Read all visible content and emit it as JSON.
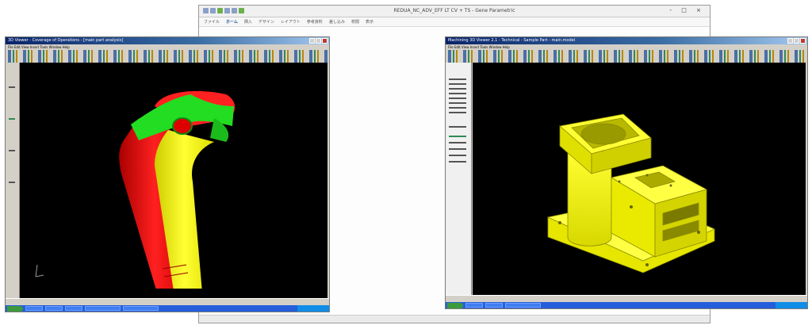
{
  "background_window": {
    "title": "REDUA_NC_ADV_EFF LT CV + TS - Gene Parametric",
    "window_buttons": "- □ ×",
    "ribbon_tabs": [
      "ファイル",
      "ホーム",
      "挿入",
      "デザイン",
      "レイアウト",
      "参考資料",
      "差し込み",
      "校閲",
      "表示"
    ],
    "active_tab_index": 1
  },
  "left_app": {
    "title": "3D Viewer - Coverage of Operations - [main part analysis]",
    "menu": "File  Edit  View  Insert  Tools  Window  Help",
    "model_colors": [
      "#ff1a1a",
      "#ffff1a",
      "#22dd22"
    ]
  },
  "right_app": {
    "title": "Machining 3D Viewer 2.1 - Technical - Sample Part - main.model",
    "menu": "File  Edit  View  Insert  Tools  Window  Help",
    "model_color": "#ffff00"
  },
  "colors": {
    "viewport_bg": "#000000",
    "window_chrome": "#d4d0c8",
    "taskbar": "#245edb"
  }
}
